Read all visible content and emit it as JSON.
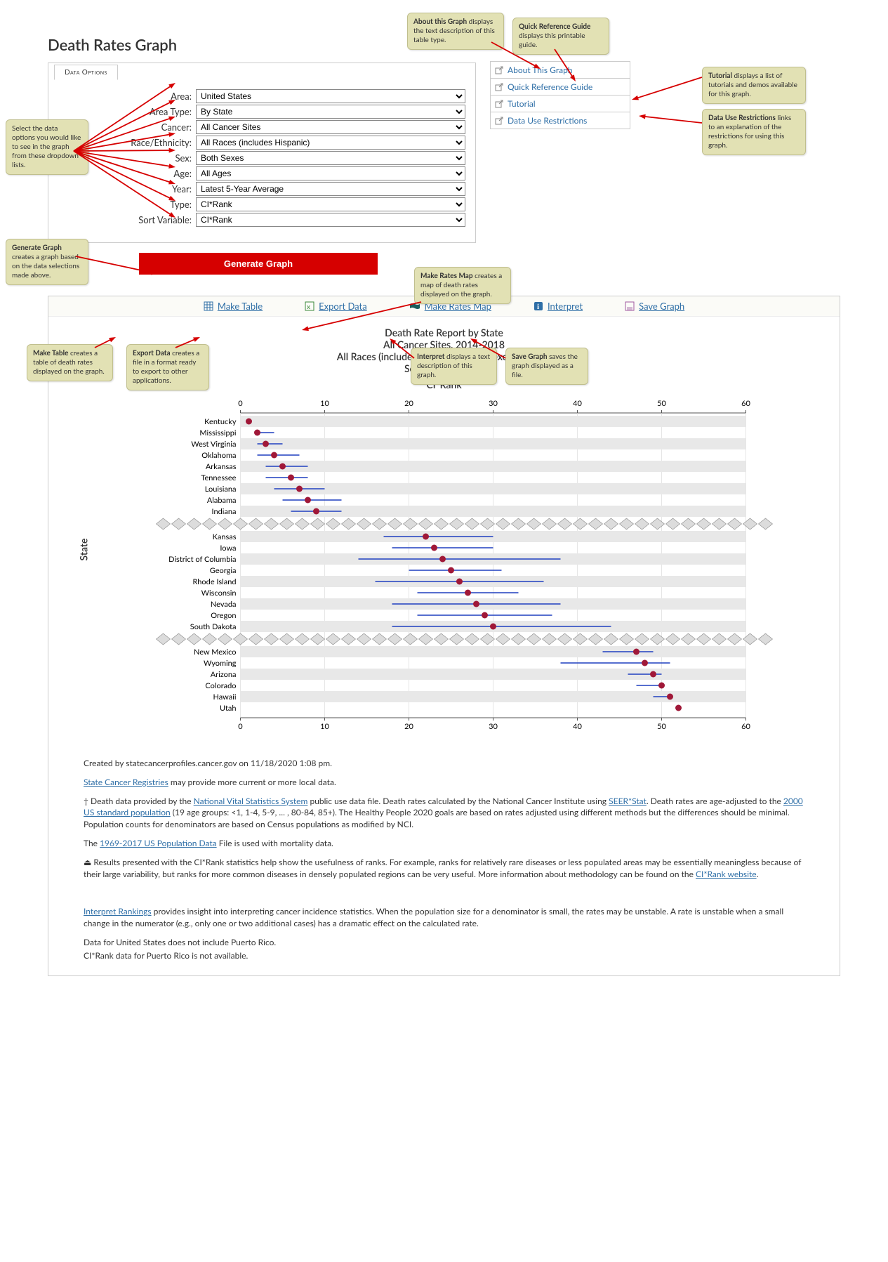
{
  "page_title": "Death Rates Graph",
  "tab_label": "Data Options",
  "form": {
    "area": {
      "label": "Area:",
      "value": "United States"
    },
    "areatype": {
      "label": "Area Type:",
      "value": "By State"
    },
    "cancer": {
      "label": "Cancer:",
      "value": "All Cancer Sites"
    },
    "race": {
      "label": "Race/Ethnicity:",
      "value": "All Races (includes Hispanic)"
    },
    "sex": {
      "label": "Sex:",
      "value": "Both Sexes"
    },
    "age": {
      "label": "Age:",
      "value": "All Ages"
    },
    "year": {
      "label": "Year:",
      "value": "Latest 5-Year Average"
    },
    "type": {
      "label": "Type:",
      "value": "CI*Rank"
    },
    "sort": {
      "label": "Sort Variable:",
      "value": "CI*Rank"
    }
  },
  "generate_label": "Generate Graph",
  "right_links": [
    "About This Graph",
    "Quick Reference Guide",
    "Tutorial",
    "Data Use Restrictions"
  ],
  "action_links": {
    "make_table": "Make Table",
    "export": "Export Data",
    "map": "Make Rates Map",
    "interpret": "Interpret",
    "save": "Save Graph"
  },
  "report_title_lines": [
    "Death Rate Report by State",
    "All Cancer Sites, 2014-2018",
    "All Races (includes Hispanic), Both Sexes, All Ages",
    "Sorted by CI*Rank"
  ],
  "callouts": {
    "about": "<b>About this Graph</b> displays the text description of this table type.",
    "quickref": "<b>Quick Reference Guide</b> displays this printable guide.",
    "tutorial": "<b>Tutorial</b> displays a list of tutorials and demos available for this graph.",
    "datause": "<b>Data Use Restrictions</b> links to an explanation of the restrictions for using this graph.",
    "select": "Select the data options you would like to see in the graph from these dropdown lists.",
    "generate": "<b>Generate Graph</b> creates a graph based on the data selections made above.",
    "ratesmap": "<b>Make Rates Map</b> creates a map of death rates displayed on the graph.",
    "maketable": "<b>Make Table</b> creates a table of death rates displayed on the graph.",
    "export": "<b>Export Data</b> creates a file in a format ready to export to other applications.",
    "interpret": "<b>Interpret</b> displays a text description of this graph.",
    "savegraph": "<b>Save Graph</b> saves the graph displayed as a file."
  },
  "chart_data": {
    "type": "dot-ci",
    "x_title": "CI*Rank",
    "y_title": "State",
    "xlim": [
      0,
      60
    ],
    "xticks": [
      0,
      10,
      20,
      30,
      40,
      50,
      60
    ],
    "groups": [
      {
        "rows": [
          {
            "state": "Kentucky",
            "rank": 1,
            "lo": 1,
            "hi": 1
          },
          {
            "state": "Mississippi",
            "rank": 2,
            "lo": 2,
            "hi": 4
          },
          {
            "state": "West Virginia",
            "rank": 3,
            "lo": 2,
            "hi": 5
          },
          {
            "state": "Oklahoma",
            "rank": 4,
            "lo": 2,
            "hi": 7
          },
          {
            "state": "Arkansas",
            "rank": 5,
            "lo": 3,
            "hi": 8
          },
          {
            "state": "Tennessee",
            "rank": 6,
            "lo": 3,
            "hi": 8
          },
          {
            "state": "Louisiana",
            "rank": 7,
            "lo": 4,
            "hi": 10
          },
          {
            "state": "Alabama",
            "rank": 8,
            "lo": 5,
            "hi": 12
          },
          {
            "state": "Indiana",
            "rank": 9,
            "lo": 6,
            "hi": 12
          }
        ]
      },
      {
        "rows": [
          {
            "state": "Kansas",
            "rank": 22,
            "lo": 17,
            "hi": 30
          },
          {
            "state": "Iowa",
            "rank": 23,
            "lo": 18,
            "hi": 30
          },
          {
            "state": "District of Columbia",
            "rank": 24,
            "lo": 14,
            "hi": 38
          },
          {
            "state": "Georgia",
            "rank": 25,
            "lo": 20,
            "hi": 31
          },
          {
            "state": "Rhode Island",
            "rank": 26,
            "lo": 16,
            "hi": 36
          },
          {
            "state": "Wisconsin",
            "rank": 27,
            "lo": 21,
            "hi": 33
          },
          {
            "state": "Nevada",
            "rank": 28,
            "lo": 18,
            "hi": 38
          },
          {
            "state": "Oregon",
            "rank": 29,
            "lo": 21,
            "hi": 37
          },
          {
            "state": "South Dakota",
            "rank": 30,
            "lo": 18,
            "hi": 44
          }
        ]
      },
      {
        "rows": [
          {
            "state": "New Mexico",
            "rank": 47,
            "lo": 43,
            "hi": 49
          },
          {
            "state": "Wyoming",
            "rank": 48,
            "lo": 38,
            "hi": 51
          },
          {
            "state": "Arizona",
            "rank": 49,
            "lo": 46,
            "hi": 50
          },
          {
            "state": "Colorado",
            "rank": 50,
            "lo": 47,
            "hi": 50
          },
          {
            "state": "Hawaii",
            "rank": 51,
            "lo": 49,
            "hi": 51
          },
          {
            "state": "Utah",
            "rank": 52,
            "lo": 52,
            "hi": 52
          }
        ]
      }
    ]
  },
  "footer": {
    "created": "Created by statecancerprofiles.cancer.gov on 11/18/2020 1:08 pm.",
    "p1_link": "State Cancer Registries",
    "p1_rest": " may provide more current or more local data.",
    "p2": "† Death data provided by the <a>National Vital Statistics System</a> public use data file. Death rates calculated by the National Cancer Institute using <a>SEER*Stat</a>. Death rates are age-adjusted to the <a>2000 US standard population</a> (19 age groups: <1, 1-4, 5-9, ... , 80-84, 85+). The Healthy People 2020 goals are based on rates adjusted using different methods but the differences should be minimal. Population counts for denominators are based on Census populations as modified by NCI.",
    "p3": "The <a>1969-2017 US Population Data</a> File is used with mortality data.",
    "p4": "⏏ Results presented with the CI*Rank statistics help show the usefulness of ranks. For example, ranks for relatively rare diseases or less populated areas may be essentially meaningless because of their large variability, but ranks for more common diseases in densely populated regions can be very useful. More information about methodology can be found on the <a>CI*Rank website</a>.",
    "p5": "<a>Interpret Rankings</a> provides insight into interpreting cancer incidence statistics. When the population size for a denominator is small, the rates may be unstable. A rate is unstable when a small change in the numerator (e.g., only one or two additional cases) has a dramatic effect on the calculated rate.",
    "p6": "Data for United States does not include Puerto Rico.",
    "p7": "CI*Rank data for Puerto Rico is not available."
  }
}
